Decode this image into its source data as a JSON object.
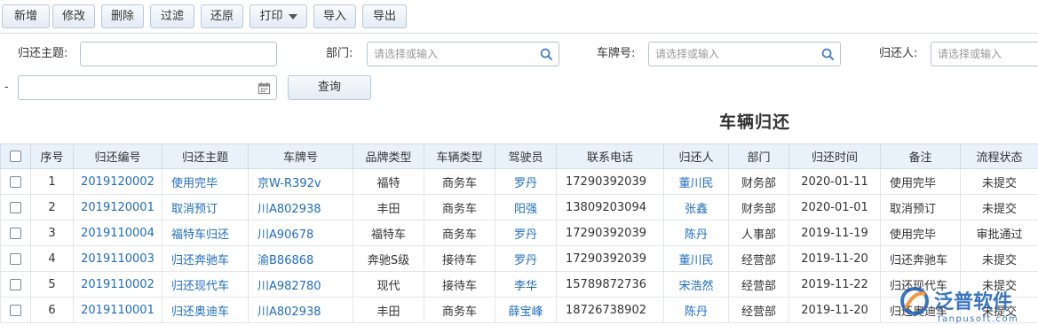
{
  "toolbar": {
    "add": "新增",
    "edit": "修改",
    "delete": "删除",
    "filter": "过滤",
    "restore": "还原",
    "print": "打印",
    "import": "导入",
    "export": "导出"
  },
  "filters": {
    "subject_label": "归还主题:",
    "subject_value": "",
    "dept_label": "部门:",
    "dept_placeholder": "请选择或输入",
    "plate_label": "车牌号:",
    "plate_placeholder": "请选择或输入",
    "returner_label": "归还人:",
    "returner_placeholder": "请选择或输入",
    "date_sep": "-",
    "date_value": "",
    "query": "查询"
  },
  "page_title": "车辆归还",
  "table": {
    "headers": [
      "序号",
      "归还编号",
      "归还主题",
      "车牌号",
      "品牌类型",
      "车辆类型",
      "驾驶员",
      "联系电话",
      "归还人",
      "部门",
      "归还时间",
      "备注",
      "流程状态"
    ],
    "rows": [
      [
        "1",
        "2019120002",
        "使用完毕",
        "京W-R392v",
        "福特",
        "商务车",
        "罗丹",
        "17290392039",
        "董川民",
        "财务部",
        "2020-01-11",
        "使用完毕",
        "未提交"
      ],
      [
        "2",
        "2019120001",
        "取消预订",
        "川A802938",
        "丰田",
        "商务车",
        "阳强",
        "13809203094",
        "张鑫",
        "财务部",
        "2020-01-01",
        "取消预订",
        "未提交"
      ],
      [
        "3",
        "2019110004",
        "福特车归还",
        "川A90678",
        "福特车",
        "商务车",
        "罗丹",
        "17290392039",
        "陈丹",
        "人事部",
        "2019-11-19",
        "使用完毕",
        "审批通过"
      ],
      [
        "4",
        "2019110003",
        "归还奔驰车",
        "渝B86868",
        "奔驰S级",
        "接待车",
        "罗丹",
        "17290392039",
        "董川民",
        "经营部",
        "2019-11-20",
        "归还奔驰车",
        "未提交"
      ],
      [
        "5",
        "2019110002",
        "归还现代车",
        "川A982780",
        "现代",
        "接待车",
        "李华",
        "15789872736",
        "宋浩然",
        "经营部",
        "2019-11-22",
        "归还现代车",
        "未提交"
      ],
      [
        "6",
        "2019110001",
        "归还奥迪车",
        "川A802938",
        "丰田",
        "商务车",
        "薛宝峰",
        "18726738902",
        "陈丹",
        "经营部",
        "2019-11-20",
        "归还奥迪车",
        "未提交"
      ]
    ]
  },
  "watermark": {
    "name": "泛普软件",
    "url": "fanpusoft.com"
  },
  "colors": {
    "link": "#1f6dbf",
    "header_bg": "#e9f1fa",
    "watermark": "#1a5fb4"
  }
}
